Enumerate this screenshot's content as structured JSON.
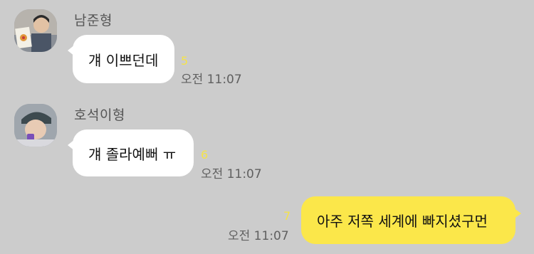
{
  "messages": [
    {
      "sender": "남준형",
      "text": "걔 이쁘던데",
      "unread": "5",
      "time": "오전 11:07",
      "avatar_icon": "profile-photo-person-holding-book"
    },
    {
      "sender": "호석이형",
      "text": "걔 졸라예뻐 ㅠ",
      "unread": "6",
      "time": "오전 11:07",
      "avatar_icon": "profile-photo-person-beanie"
    },
    {
      "text": "아주 저쪽 세계에 빠지셨구먼",
      "unread": "7",
      "time": "오전 11:07"
    }
  ],
  "colors": {
    "background": "#cccccc",
    "incoming_bubble": "#ffffff",
    "outgoing_bubble": "#fbe74a",
    "unread_count": "#f5e34a"
  }
}
